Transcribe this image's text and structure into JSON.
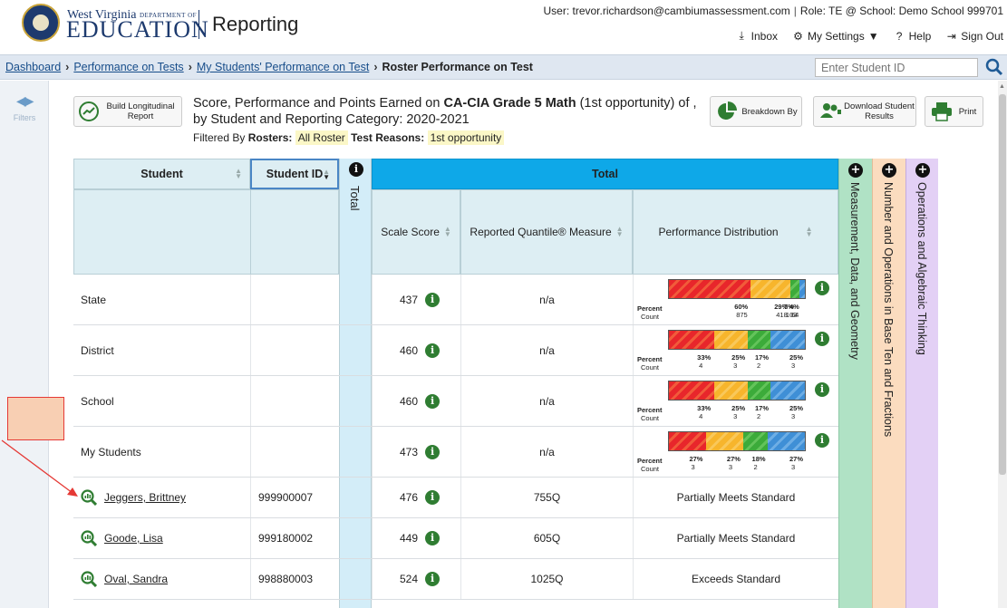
{
  "header": {
    "brand_top": "West Virginia",
    "brand_dept": "DEPARTMENT OF",
    "brand_main": "EDUCATION",
    "app_title": "Reporting",
    "user": "User: trevor.richardson@cambiumassessment.com",
    "role": "Role: TE @ School: Demo School 999701",
    "utility": {
      "inbox": "Inbox",
      "settings": "My Settings",
      "help": "Help",
      "signout": "Sign Out"
    }
  },
  "breadcrumb": {
    "items": [
      "Dashboard",
      "Performance on Tests",
      "My Students' Performance on Test"
    ],
    "current": "Roster Performance on Test",
    "student_id_placeholder": "Enter Student ID"
  },
  "rail": {
    "label": "Filters"
  },
  "report": {
    "build_btn": "Build Longitudinal Report",
    "title_prefix": "Score, Performance and Points Earned on ",
    "title_test": "CA-CIA Grade 5 Math",
    "title_suffix": " (1st opportunity) of ,",
    "title_line2": "by Student and Reporting Category: 2020-2021",
    "filter_prefix": "Filtered By",
    "filter_rosters_label": "Rosters:",
    "filter_rosters_value": "All Roster",
    "filter_reasons_label": "Test Reasons:",
    "filter_reasons_value": "1st opportunity",
    "breakdown_btn": "Breakdown By",
    "download_btn": "Download Student Results",
    "print_btn": "Print"
  },
  "table": {
    "col_student": "Student",
    "col_id": "Student ID",
    "col_total_vertical": "Total",
    "col_total": "Total",
    "sub_scale": "Scale Score",
    "sub_quant": "Reported Quantile® Measure",
    "sub_perf": "Performance Distribution",
    "claims": [
      "Measurement, Data, and Geometry",
      "Number and Operations in Base Ten and Fractions",
      "Operations and Algebraic Thinking"
    ],
    "agg_labels": {
      "percent": "Percent",
      "count": "Count"
    },
    "aggregate_rows": [
      {
        "name": "State",
        "scale": "437",
        "quant": "n/a",
        "dist": {
          "pct": [
            60,
            29,
            7,
            4
          ],
          "pct_labels": [
            "60%",
            "29%",
            "7%",
            "4%"
          ],
          "counts": [
            "875",
            "418",
            "103",
            "64"
          ]
        }
      },
      {
        "name": "District",
        "scale": "460",
        "quant": "n/a",
        "dist": {
          "pct": [
            33,
            25,
            17,
            25
          ],
          "pct_labels": [
            "33%",
            "25%",
            "17%",
            "25%"
          ],
          "counts": [
            "4",
            "3",
            "2",
            "3"
          ]
        }
      },
      {
        "name": "School",
        "scale": "460",
        "quant": "n/a",
        "dist": {
          "pct": [
            33,
            25,
            17,
            25
          ],
          "pct_labels": [
            "33%",
            "25%",
            "17%",
            "25%"
          ],
          "counts": [
            "4",
            "3",
            "2",
            "3"
          ]
        }
      },
      {
        "name": "My Students",
        "scale": "473",
        "quant": "n/a",
        "dist": {
          "pct": [
            27,
            27,
            18,
            27
          ],
          "pct_labels": [
            "27%",
            "27%",
            "18%",
            "27%"
          ],
          "counts": [
            "3",
            "3",
            "2",
            "3"
          ]
        }
      }
    ],
    "student_rows": [
      {
        "name": "Jeggers, Brittney",
        "id": "999900007",
        "scale": "476",
        "quant": "755Q",
        "level": "Partially Meets Standard"
      },
      {
        "name": "Goode, Lisa",
        "id": "999180002",
        "scale": "449",
        "quant": "605Q",
        "level": "Partially Meets Standard"
      },
      {
        "name": "Oval, Sandra",
        "id": "998880003",
        "scale": "524",
        "quant": "1025Q",
        "level": "Exceeds Standard"
      }
    ]
  },
  "colors": {
    "total_header": "#0ea8e8",
    "claim1": "#b0e2c5",
    "claim2": "#fbdcbf",
    "claim3": "#e3d0f5",
    "link": "#174d8a"
  }
}
